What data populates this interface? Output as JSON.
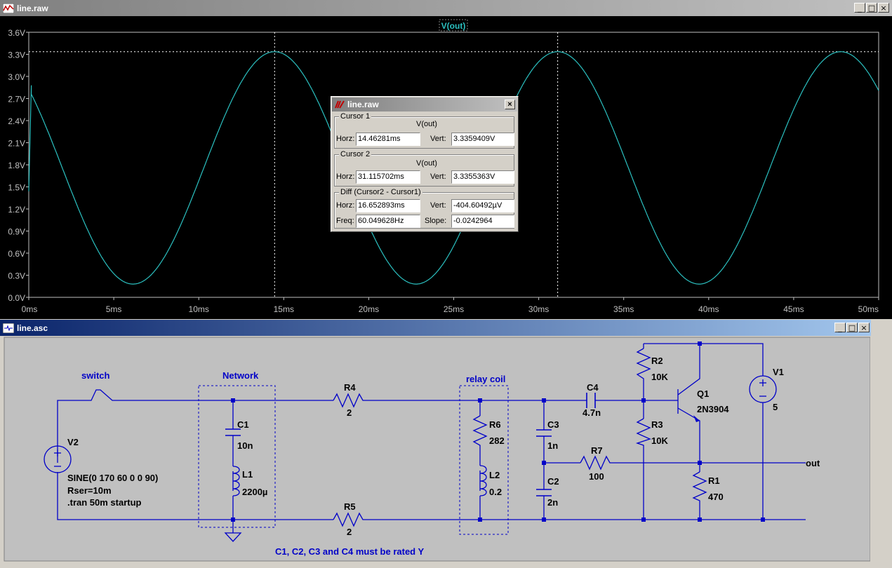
{
  "plot_window": {
    "title": "line.raw",
    "trace_label": "V(out)",
    "trace_color": "#2bc0c0",
    "y_ticks": [
      "0.0V",
      "0.3V",
      "0.6V",
      "0.9V",
      "1.2V",
      "1.5V",
      "1.8V",
      "2.1V",
      "2.4V",
      "2.7V",
      "3.0V",
      "3.3V",
      "3.6V"
    ],
    "x_ticks": [
      "0ms",
      "5ms",
      "10ms",
      "15ms",
      "20ms",
      "25ms",
      "30ms",
      "35ms",
      "40ms",
      "45ms",
      "50ms"
    ]
  },
  "chart_data": {
    "type": "line",
    "title": "",
    "xlabel": "",
    "ylabel": "",
    "xlim": [
      0,
      50
    ],
    "ylim": [
      0,
      3.6
    ],
    "x_unit": "ms",
    "y_unit": "V",
    "series": [
      {
        "name": "V(out)",
        "waveform": "sine",
        "frequency_hz": 60.05,
        "max_v": 3.336,
        "min_v": 0.18,
        "first_peak_ms": 14.46,
        "initial_v": 2.88
      }
    ],
    "cursors": [
      {
        "x_ms": 14.46281,
        "y_v": 3.3359409
      },
      {
        "x_ms": 31.115702,
        "y_v": 3.3355363
      }
    ]
  },
  "cursor_dialog": {
    "title": "line.raw",
    "cursor1": {
      "group": "Cursor 1",
      "trace": "V(out)",
      "horz_label": "Horz:",
      "horz": "14.46281ms",
      "vert_label": "Vert:",
      "vert": "3.3359409V"
    },
    "cursor2": {
      "group": "Cursor 2",
      "trace": "V(out)",
      "horz_label": "Horz:",
      "horz": "31.115702ms",
      "vert_label": "Vert:",
      "vert": "3.3355363V"
    },
    "diff": {
      "group": "Diff (Cursor2 - Cursor1)",
      "horz_label": "Horz:",
      "horz": "16.652893ms",
      "vert_label": "Vert:",
      "vert": "-404.60492µV",
      "freq_label": "Freq:",
      "freq": "60.049628Hz",
      "slope_label": "Slope:",
      "slope": "-0.0242964"
    }
  },
  "schematic_window": {
    "title": "line.asc",
    "labels": {
      "switch": "switch",
      "network": "Network",
      "relay": "relay coil",
      "v2": "V2",
      "v2_spec1": "SINE(0 170 60 0 0 90)",
      "v2_spec2": "Rser=10m",
      "v2_spec3": ".tran 50m startup",
      "c1": "C1",
      "c1v": "10n",
      "l1": "L1",
      "l1v": "2200µ",
      "r4": "R4",
      "r4v": "2",
      "r5": "R5",
      "r5v": "2",
      "r6": "R6",
      "r6v": "282",
      "l2": "L2",
      "l2v": "0.2",
      "c3": "C3",
      "c3v": "1n",
      "c2": "C2",
      "c2v": "2n",
      "c4": "C4",
      "c4v": "4.7n",
      "r7": "R7",
      "r7v": "100",
      "r2": "R2",
      "r2v": "10K",
      "r3": "R3",
      "r3v": "10K",
      "q1": "Q1",
      "q1v": "2N3904",
      "r1": "R1",
      "r1v": "470",
      "v1": "V1",
      "v1v": "5",
      "out": "out",
      "note": "C1, C2, C3 and C4 must be rated Y"
    }
  }
}
